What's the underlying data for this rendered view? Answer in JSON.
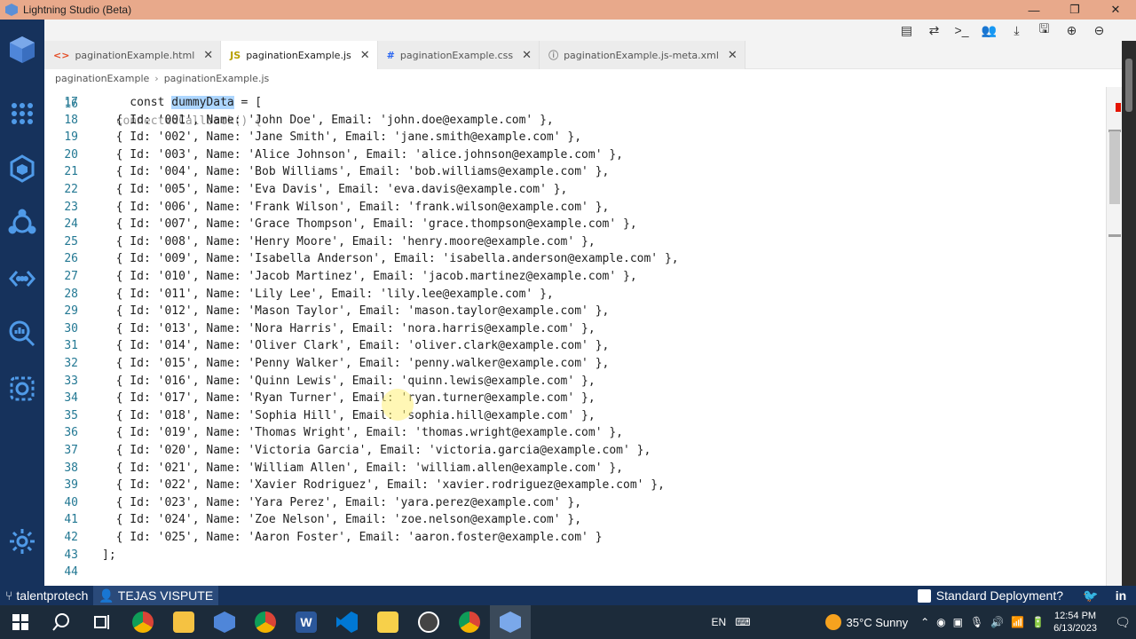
{
  "window": {
    "title": "Lightning Studio (Beta)",
    "minimize": "—",
    "restore": "❐",
    "close": "✕"
  },
  "toolbar": {
    "icons": [
      "file-icon",
      "switch-icon",
      "terminal-icon",
      "users-icon",
      "download-icon",
      "save-icon",
      "zoom-in-icon",
      "zoom-out-icon"
    ]
  },
  "tabs": [
    {
      "label": "paginationExample.html",
      "icon": "<>",
      "icon_color": "#e44d26",
      "active": false
    },
    {
      "label": "paginationExample.js",
      "icon": "JS",
      "icon_color": "#c8b400",
      "active": true
    },
    {
      "label": "paginationExample.css",
      "icon": "#",
      "icon_color": "#2965f1",
      "active": false
    },
    {
      "label": "paginationExample.js-meta.xml",
      "icon": "ⓘ",
      "icon_color": "#888888",
      "active": false
    }
  ],
  "breadcrumb": {
    "folder": "paginationExample",
    "file": "paginationExample.js"
  },
  "editor": {
    "partial_top": "  connectedCallback() {",
    "partial_top_number": "16",
    "lines": [
      {
        "n": "17",
        "pre": "    const ",
        "sel": "dummyData",
        "post": " = ["
      },
      {
        "n": "18",
        "text": "  { Id: '001', Name: 'John Doe', Email: 'john.doe@example.com' },"
      },
      {
        "n": "19",
        "text": "  { Id: '002', Name: 'Jane Smith', Email: 'jane.smith@example.com' },"
      },
      {
        "n": "20",
        "text": "  { Id: '003', Name: 'Alice Johnson', Email: 'alice.johnson@example.com' },"
      },
      {
        "n": "21",
        "text": "  { Id: '004', Name: 'Bob Williams', Email: 'bob.williams@example.com' },"
      },
      {
        "n": "22",
        "text": "  { Id: '005', Name: 'Eva Davis', Email: 'eva.davis@example.com' },"
      },
      {
        "n": "23",
        "text": "  { Id: '006', Name: 'Frank Wilson', Email: 'frank.wilson@example.com' },"
      },
      {
        "n": "24",
        "text": "  { Id: '007', Name: 'Grace Thompson', Email: 'grace.thompson@example.com' },"
      },
      {
        "n": "25",
        "text": "  { Id: '008', Name: 'Henry Moore', Email: 'henry.moore@example.com' },"
      },
      {
        "n": "26",
        "text": "  { Id: '009', Name: 'Isabella Anderson', Email: 'isabella.anderson@example.com' },"
      },
      {
        "n": "27",
        "text": "  { Id: '010', Name: 'Jacob Martinez', Email: 'jacob.martinez@example.com' },"
      },
      {
        "n": "28",
        "text": "  { Id: '011', Name: 'Lily Lee', Email: 'lily.lee@example.com' },"
      },
      {
        "n": "29",
        "text": "  { Id: '012', Name: 'Mason Taylor', Email: 'mason.taylor@example.com' },"
      },
      {
        "n": "30",
        "text": "  { Id: '013', Name: 'Nora Harris', Email: 'nora.harris@example.com' },"
      },
      {
        "n": "31",
        "text": "  { Id: '014', Name: 'Oliver Clark', Email: 'oliver.clark@example.com' },"
      },
      {
        "n": "32",
        "text": "  { Id: '015', Name: 'Penny Walker', Email: 'penny.walker@example.com' },"
      },
      {
        "n": "33",
        "text": "  { Id: '016', Name: 'Quinn Lewis', Email: 'quinn.lewis@example.com' },"
      },
      {
        "n": "34",
        "text": "  { Id: '017', Name: 'Ryan Turner', Email: 'ryan.turner@example.com' },"
      },
      {
        "n": "35",
        "text": "  { Id: '018', Name: 'Sophia Hill', Email: 'sophia.hill@example.com' },"
      },
      {
        "n": "36",
        "text": "  { Id: '019', Name: 'Thomas Wright', Email: 'thomas.wright@example.com' },"
      },
      {
        "n": "37",
        "text": "  { Id: '020', Name: 'Victoria Garcia', Email: 'victoria.garcia@example.com' },"
      },
      {
        "n": "38",
        "text": "  { Id: '021', Name: 'William Allen', Email: 'william.allen@example.com' },"
      },
      {
        "n": "39",
        "text": "  { Id: '022', Name: 'Xavier Rodriguez', Email: 'xavier.rodriguez@example.com' },"
      },
      {
        "n": "40",
        "text": "  { Id: '023', Name: 'Yara Perez', Email: 'yara.perez@example.com' },"
      },
      {
        "n": "41",
        "text": "  { Id: '024', Name: 'Zoe Nelson', Email: 'zoe.nelson@example.com' },"
      },
      {
        "n": "42",
        "text": "  { Id: '025', Name: 'Aaron Foster', Email: 'aaron.foster@example.com' }"
      },
      {
        "n": "43",
        "text": "];"
      },
      {
        "n": "44",
        "text": ""
      }
    ]
  },
  "statusbar": {
    "org": "talentprotech",
    "user": "TEJAS VISPUTE",
    "deploy_label": "Standard Deployment?"
  },
  "taskbar": {
    "apps": [
      "windows-start",
      "search",
      "task-view",
      "chrome",
      "file-explorer",
      "lightning-studio",
      "chrome-profile",
      "word",
      "vscode",
      "notes",
      "media-player",
      "chrome-alt",
      "lightning-studio-active"
    ],
    "lang": "EN",
    "weather": "35°C  Sunny",
    "time": "12:54 PM",
    "date": "6/13/2023"
  },
  "colors": {
    "activity_bar": "#16325c",
    "title_bar": "#e8a98b",
    "string": "#a31515",
    "keyword": "#0000ff",
    "property": "#1f1f1f"
  }
}
